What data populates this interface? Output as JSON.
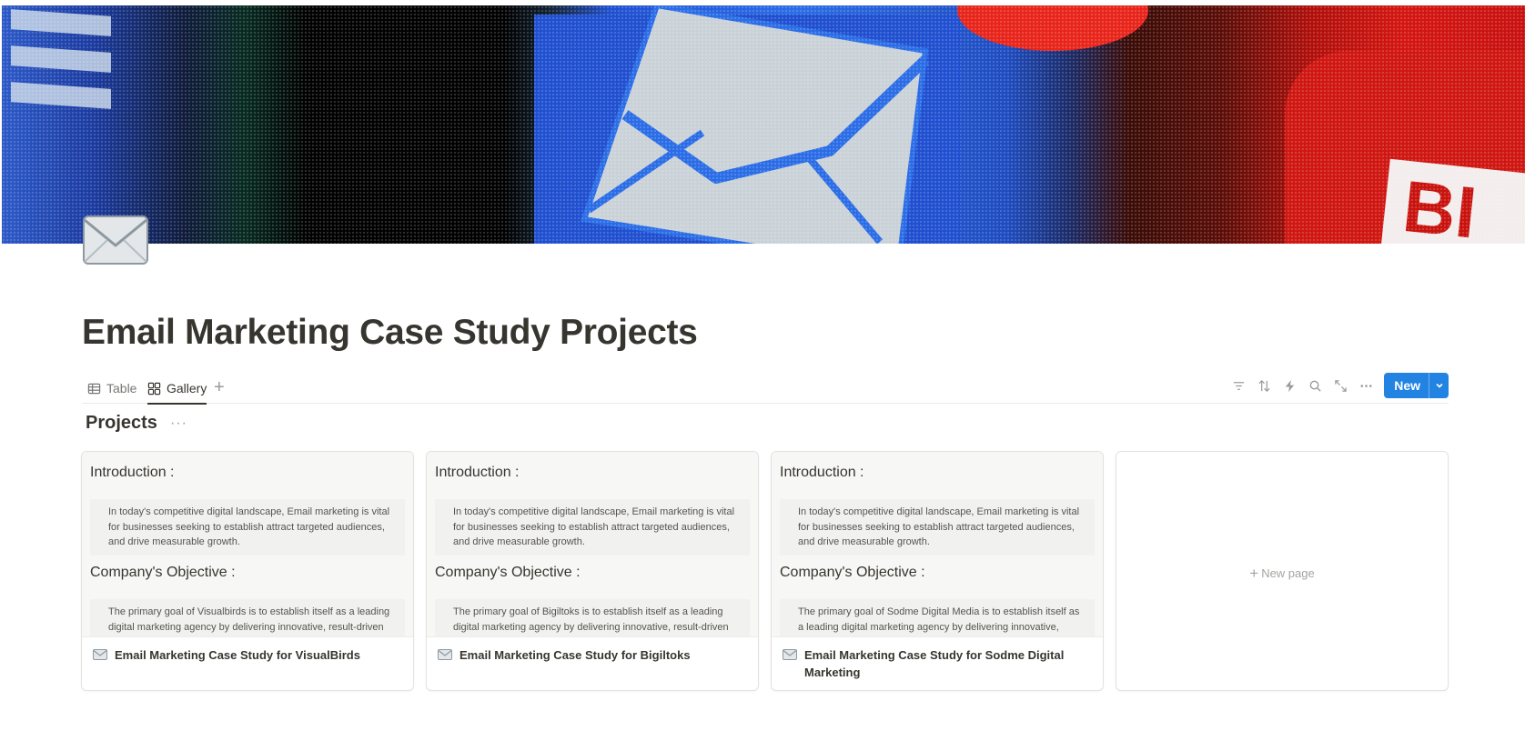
{
  "page": {
    "title": "Email Marketing Case Study Projects",
    "icon": "envelope-icon"
  },
  "views": {
    "tabs": [
      {
        "label": "Table",
        "icon": "table-icon",
        "active": false
      },
      {
        "label": "Gallery",
        "icon": "gallery-icon",
        "active": true
      }
    ],
    "add_view_label": "+"
  },
  "toolbar": {
    "icons": [
      "filter-icon",
      "sort-icon",
      "automation-icon",
      "search-icon",
      "expand-icon",
      "more-icon"
    ],
    "new_label": "New"
  },
  "database": {
    "title": "Projects",
    "more_label": "···"
  },
  "gallery": {
    "cards": [
      {
        "intro_heading": "Introduction :",
        "intro_text": "In today's competitive digital landscape, Email marketing is vital for businesses seeking to establish attract targeted audiences, and drive measurable growth.",
        "objective_heading": "Company's Objective :",
        "objective_text": "The primary goal of Visualbirds is to establish itself as a leading digital marketing agency by delivering innovative, result-driven marketing solutions. The agency aims to help",
        "name": "Email Marketing Case Study for VisualBirds"
      },
      {
        "intro_heading": "Introduction :",
        "intro_text": "In today's competitive digital landscape, Email marketing is vital for businesses seeking to establish attract targeted audiences, and drive measurable growth.",
        "objective_heading": "Company's Objective :",
        "objective_text": "The primary goal of Bigiltoks is to establish itself as a leading digital marketing agency by delivering innovative, result-driven marketing solutions. The agency aims to help",
        "name": "Email Marketing Case Study for Bigiltoks"
      },
      {
        "intro_heading": "Introduction :",
        "intro_text": "In today's competitive digital landscape, Email marketing is vital for businesses seeking to establish attract targeted audiences, and drive measurable growth.",
        "objective_heading": "Company's Objective :",
        "objective_text": "The primary goal of Sodme Digital Media is to establish itself as a leading digital marketing agency by delivering innovative, result-driven marketing solutions. The agency aims to help",
        "name": "Email Marketing Case Study for Sodme Digital Marketing"
      }
    ],
    "new_page_label": "New page"
  },
  "colors": {
    "accent": "#2383e2",
    "text": "#37352f",
    "muted": "#9b9a97"
  }
}
